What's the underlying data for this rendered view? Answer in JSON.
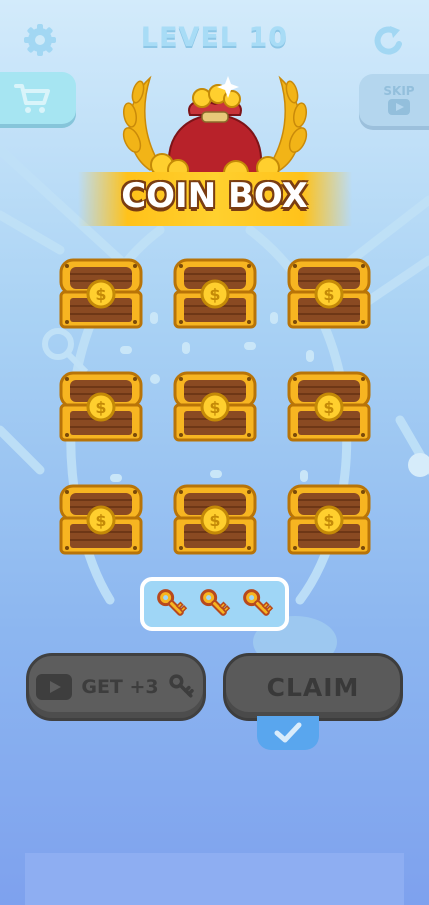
{
  "header": {
    "level_label": "LEVEL 10",
    "settings_icon": "gear-icon",
    "restart_icon": "restart-icon"
  },
  "shop": {
    "icon": "cart-icon"
  },
  "skip": {
    "label": "SKIP",
    "icon": "video-icon"
  },
  "reward": {
    "title": "COIN BOX",
    "art_icon": "coin-bag-icon"
  },
  "chests": [
    {
      "icon": "chest-icon"
    },
    {
      "icon": "chest-icon"
    },
    {
      "icon": "chest-icon"
    },
    {
      "icon": "chest-icon"
    },
    {
      "icon": "chest-icon"
    },
    {
      "icon": "chest-icon"
    },
    {
      "icon": "chest-icon"
    },
    {
      "icon": "chest-icon"
    },
    {
      "icon": "chest-icon"
    }
  ],
  "keys": {
    "count": 3,
    "icon": "key-icon"
  },
  "buttons": {
    "get_more_label": "GET +3",
    "claim_label": "CLAIM"
  },
  "colors": {
    "chest_gold": "#f7b521",
    "chest_wood": "#8a4a22",
    "banner_yellow": "#ffc21a",
    "button_gray": "#5a5a5a"
  }
}
